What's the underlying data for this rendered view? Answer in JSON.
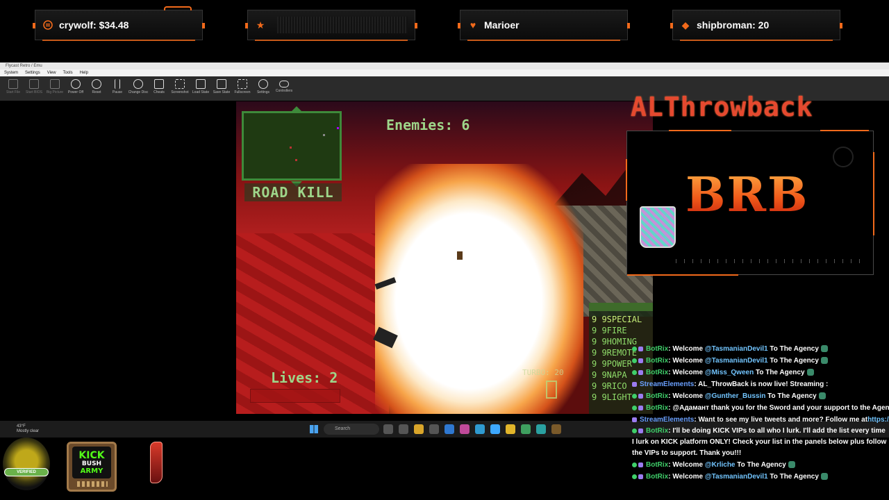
{
  "alerts": [
    {
      "icon": "coin-icon",
      "text": "crywolf: $34.48"
    },
    {
      "icon": "star-icon",
      "text": ""
    },
    {
      "icon": "heart-icon",
      "text": "Marioer"
    },
    {
      "icon": "diamond-icon",
      "text": "shipbroman: 20"
    }
  ],
  "colors": {
    "accent": "#f26a1b",
    "hud_green": "#9ed68a",
    "chat_botrix": "#3fcf6a",
    "chat_streamelements": "#6aa0ff"
  },
  "emulator": {
    "title": "Flycast Retro / Emu",
    "menu": [
      "System",
      "Settings",
      "View",
      "Tools",
      "Help"
    ],
    "toolbar": [
      {
        "label": "Start File",
        "icon": "file-icon",
        "enabled": false
      },
      {
        "label": "Start BIOS",
        "icon": "chip-icon",
        "enabled": false
      },
      {
        "label": "Big Picture",
        "icon": "monitor-icon",
        "enabled": false
      },
      {
        "label": "Power Off",
        "icon": "power-icon",
        "enabled": true
      },
      {
        "label": "Reset",
        "icon": "reset-icon",
        "enabled": true
      },
      {
        "label": "Pause",
        "icon": "pause-icon",
        "enabled": true
      },
      {
        "label": "Change Disc",
        "icon": "disc-icon",
        "enabled": true
      },
      {
        "label": "Cheats",
        "icon": "cheats-icon",
        "enabled": true
      },
      {
        "label": "Screenshot",
        "icon": "screenshot-icon",
        "enabled": true
      },
      {
        "label": "Load State",
        "icon": "folder-icon",
        "enabled": true
      },
      {
        "label": "Save State",
        "icon": "save-icon",
        "enabled": true
      },
      {
        "label": "Fullscreen",
        "icon": "fullscreen-icon",
        "enabled": true
      },
      {
        "label": "Settings",
        "icon": "gear-icon",
        "enabled": true
      },
      {
        "label": "Controllers",
        "icon": "gamepad-icon",
        "enabled": true
      }
    ]
  },
  "game": {
    "enemies": "Enemies: 6",
    "roadkill": "ROAD KILL",
    "lives": "Lives: 2",
    "turbo": "TURBO: 20",
    "weapons": [
      "9 9SPECIAL",
      "9 9FIRE",
      "9 9HOMING",
      "9 9REMOTE",
      "9 9POWER",
      "9 9NAPA",
      "9 9RICO",
      "9 9LIGHT"
    ]
  },
  "overlay": {
    "brand": "ALThrowback",
    "brb": "BRB"
  },
  "taskbar": {
    "weather_temp": "43°F",
    "weather_desc": "Mostly clear",
    "search": "Search"
  },
  "badges": {
    "verified": "VERIFIED",
    "kick_line1": "KICK",
    "kick_line2": "BUSH",
    "kick_line3": "ARMY"
  },
  "chat": [
    {
      "user": "BotRix",
      "badges": 2,
      "pre": ": Welcome ",
      "mention": "@TasmanianDevil1",
      "post": " To The Agency",
      "emote": true
    },
    {
      "user": "BotRix",
      "badges": 2,
      "pre": ": Welcome ",
      "mention": "@TasmanianDevil1",
      "post": " To The Agency",
      "emote": true
    },
    {
      "user": "BotRix",
      "badges": 2,
      "pre": ": Welcome ",
      "mention": "@Miss_Qween",
      "post": " To The Agency",
      "emote": true
    },
    {
      "user": "StreamElements",
      "badges": 1,
      "pre": ": AL_ThrowBack is now live! Streaming :",
      "mention": "",
      "post": "",
      "emote": false
    },
    {
      "user": "BotRix",
      "badges": 2,
      "pre": ": Welcome ",
      "mention": "@Gunther_Bussin",
      "post": " To The Agency",
      "emote": true
    },
    {
      "user": "BotRix",
      "badges": 2,
      "pre": ": @Адамант thank you for the Sword and your support to the Agency",
      "mention": "",
      "post": "",
      "emote": false
    },
    {
      "user": "StreamElements",
      "badges": 1,
      "pre": ": Want to see my live tweets and more? Follow me at",
      "mention": "https://twitter.com/BadsDemo",
      "post": "",
      "emote": false
    },
    {
      "user": "BotRix",
      "badges": 2,
      "pre": ": I'll be doing KICK VIPs to all who I lurk. I'll add the list every time I lurk on KICK platform ONLY! Check your list in the panels below plus follow the VIPs to support. Thank you!!!",
      "mention": "",
      "post": "",
      "emote": false,
      "wrap": true
    },
    {
      "user": "BotRix",
      "badges": 2,
      "pre": ": Welcome ",
      "mention": "@Krliche",
      "post": " To The Agency",
      "emote": true
    },
    {
      "user": "BotRix",
      "badges": 2,
      "pre": ": Welcome ",
      "mention": "@TasmanianDevil1",
      "post": " To The Agency",
      "emote": true
    }
  ]
}
